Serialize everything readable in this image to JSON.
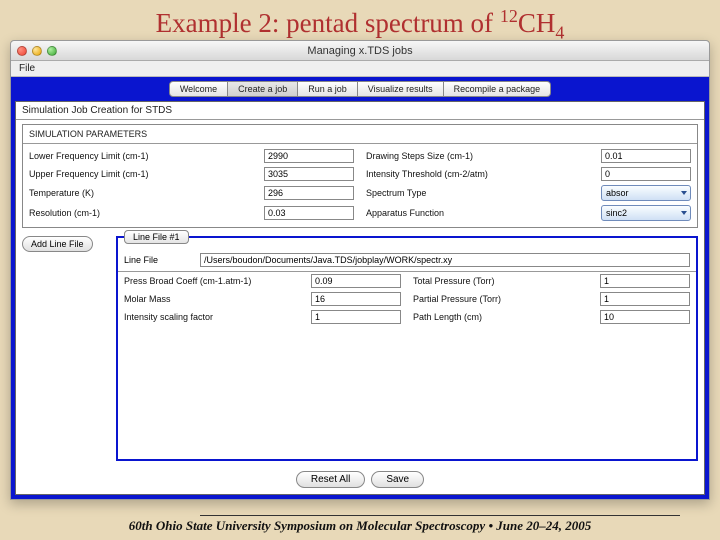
{
  "slide": {
    "title_prefix": "Example 2: pentad spectrum of ",
    "isotope_sup": "12",
    "molecule": "CH",
    "molecule_sub": "4"
  },
  "window": {
    "title": "Managing x.TDS jobs"
  },
  "menubar": {
    "file": "File"
  },
  "tabs": {
    "welcome": "Welcome",
    "create": "Create a job",
    "run": "Run a job",
    "visualize": "Visualize results",
    "recompile": "Recompile a package"
  },
  "panel": {
    "head": "Simulation Job Creation for STDS",
    "group_head": "SIMULATION PARAMETERS"
  },
  "params_left": {
    "lowfreq": {
      "label": "Lower Frequency Limit (cm-1)",
      "value": "2990"
    },
    "upfreq": {
      "label": "Upper Frequency Limit (cm-1)",
      "value": "3035"
    },
    "temp": {
      "label": "Temperature (K)",
      "value": "296"
    },
    "res": {
      "label": "Resolution (cm-1)",
      "value": "0.03"
    }
  },
  "params_right": {
    "step": {
      "label": "Drawing Steps Size (cm-1)",
      "value": "0.01"
    },
    "thresh": {
      "label": "Intensity Threshold (cm-2/atm)",
      "value": "0"
    },
    "sptype": {
      "label": "Spectrum Type",
      "value": "absor"
    },
    "appfun": {
      "label": "Apparatus Function",
      "value": "sinc2"
    }
  },
  "linefile": {
    "addbtn": "Add Line File",
    "tab": "Line File #1",
    "select": "Line File",
    "path": "/Users/boudon/Documents/Java.TDS/jobplay/WORK/spectr.xy"
  },
  "lf_left": {
    "pbc": {
      "label": "Press Broad Coeff (cm-1.atm-1)",
      "value": "0.09"
    },
    "mmass": {
      "label": "Molar Mass",
      "value": "16"
    },
    "iscale": {
      "label": "Intensity scaling factor",
      "value": "1"
    }
  },
  "lf_right": {
    "totp": {
      "label": "Total Pressure (Torr)",
      "value": "1"
    },
    "parp": {
      "label": "Partial Pressure (Torr)",
      "value": "1"
    },
    "plen": {
      "label": "Path Length (cm)",
      "value": "10"
    }
  },
  "buttons": {
    "reset": "Reset All",
    "save": "Save"
  },
  "footer": "60th Ohio State University Symposium on Molecular Spectroscopy • June 20–24, 2005"
}
